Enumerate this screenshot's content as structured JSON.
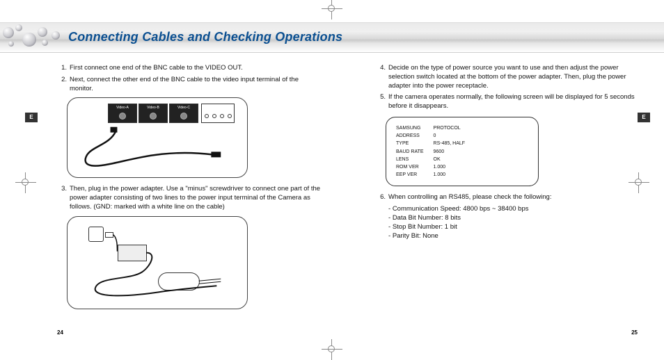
{
  "header": {
    "title": "Connecting Cables and Checking Operations",
    "side_tab": "E"
  },
  "left_column": {
    "items": [
      {
        "num": "1.",
        "text": "First connect one end of the BNC cable to the VIDEO OUT."
      },
      {
        "num": "2.",
        "text": "Next, connect the other end of the BNC cable to the video input terminal of the monitor."
      },
      {
        "num": "3.",
        "text": "Then, plug in the power adapter. Use a \"minus\" screwdriver to connect one part of the power adapter consisting of two lines to the power input terminal of the Camera as follows. (GND: marked with a white line on the cable)"
      }
    ],
    "fig1_ports": [
      "Video-A",
      "Video-B",
      "Video-C"
    ]
  },
  "right_column": {
    "items": [
      {
        "num": "4.",
        "text": "Decide on the type of power source you want to use and then adjust the power selection switch located at the bottom of the power adapter. Then, plug the power adapter into the power receptacle."
      },
      {
        "num": "5.",
        "text": "If the camera operates normally, the following screen will be displayed for 5 seconds before it disappears."
      },
      {
        "num": "6.",
        "text": "When controlling an RS485, please check the following:"
      }
    ],
    "infobox_rows": [
      [
        "SAMSUNG",
        "PROTOCOL"
      ],
      [
        "ADDRESS",
        "0"
      ],
      [
        "TYPE",
        "RS-485, HALF"
      ],
      [
        "BAUD RATE",
        "9600"
      ],
      [
        "LENS",
        "OK"
      ],
      [
        "ROM VER",
        "1.000"
      ],
      [
        "EEP VER",
        "1.000"
      ]
    ],
    "rs485_checks": [
      "Communication Speed: 4800 bps ~ 38400 bps",
      "Data Bit Number: 8 bits",
      "Stop Bit Number: 1 bit",
      "Parity Bit: None"
    ]
  },
  "page_numbers": {
    "left": "24",
    "right": "25"
  }
}
